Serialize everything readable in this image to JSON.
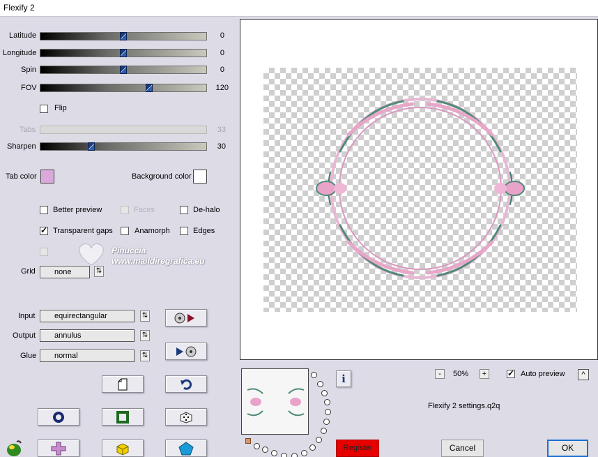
{
  "window": {
    "title": "Flexify 2"
  },
  "sliders": [
    {
      "label": "Latitude",
      "value": "0",
      "position": 0.5
    },
    {
      "label": "Longitude",
      "value": "0",
      "position": 0.5
    },
    {
      "label": "Spin",
      "value": "0",
      "position": 0.5
    },
    {
      "label": "FOV",
      "value": "120",
      "position": 0.65
    }
  ],
  "flip": {
    "label": "Flip",
    "checked": false
  },
  "tabs": {
    "label": "Tabs",
    "value": "33"
  },
  "sharpen": {
    "label": "Sharpen",
    "value": "30",
    "position": 0.3
  },
  "colors": {
    "tab_label": "Tab color",
    "tab_color": "#dba8dc",
    "background_label": "Background color",
    "background_color": "#ffffff"
  },
  "options": {
    "better_preview": "Better preview",
    "faces": "Faces",
    "de_halo": "De-halo",
    "transparent_gaps": "Transparent gaps",
    "anamorph": "Anamorph",
    "edges": "Edges"
  },
  "grid": {
    "label": "Grid",
    "value": "none"
  },
  "projection": {
    "input_label": "Input",
    "input_value": "equirectangular",
    "output_label": "Output",
    "output_value": "annulus",
    "glue_label": "Glue",
    "glue_value": "normal"
  },
  "watermark": {
    "line1": "Pinuccia",
    "line2": "www.maildiregrafica.eu"
  },
  "zoom": {
    "minus": "-",
    "value": "50%",
    "plus": "+"
  },
  "auto_preview": {
    "label": "Auto preview",
    "checked": true,
    "up": "^"
  },
  "settings_file": "Flexify 2 settings.q2q",
  "buttons": {
    "register": "Register",
    "cancel": "Cancel",
    "ok": "OK",
    "info": "i"
  },
  "icons": [
    "swap-icon",
    "new-file-icon",
    "undo-icon",
    "ring-icon",
    "square-icon",
    "dice-icon",
    "plugin-logo-icon",
    "cross-shape-icon",
    "cube-icon",
    "pentagon-icon"
  ]
}
